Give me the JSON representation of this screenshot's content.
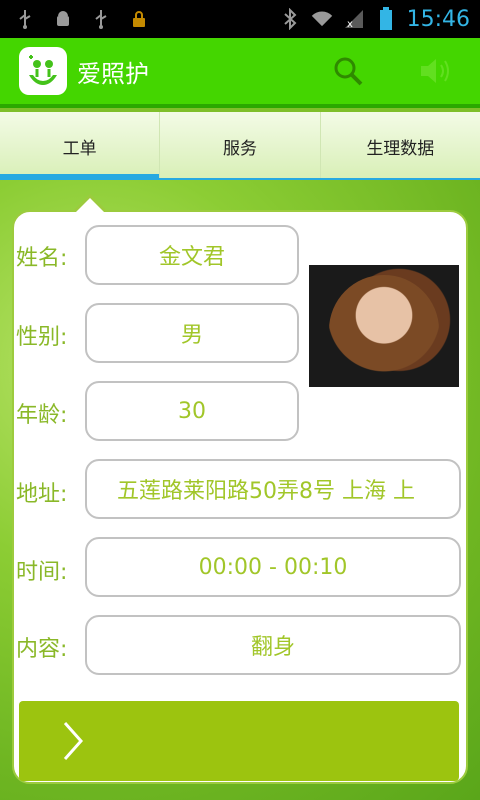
{
  "status_bar": {
    "time": "15:46",
    "icons": [
      "usb-icon",
      "android-debug-icon",
      "usb-icon",
      "lock-icon",
      "bluetooth-icon",
      "wifi-icon",
      "signal-icon",
      "battery-icon"
    ]
  },
  "app": {
    "title": "爱照护",
    "logo_icon": "caregiver-hands-icon",
    "actions": [
      "search-icon",
      "volume-icon"
    ]
  },
  "tabs": [
    {
      "label": "工单",
      "active": true
    },
    {
      "label": "服务",
      "active": false
    },
    {
      "label": "生理数据",
      "active": false
    }
  ],
  "form": {
    "name": {
      "label": "姓名:",
      "value": "金文君"
    },
    "gender": {
      "label": "性别:",
      "value": "男"
    },
    "age": {
      "label": "年龄:",
      "value": "30"
    },
    "address": {
      "label": "地址:",
      "value": "五莲路莱阳路50弄8号 上海 上"
    },
    "time": {
      "label": "时间:",
      "value": "00:00 - 00:10"
    },
    "content": {
      "label": "内容:",
      "value": "翻身"
    }
  },
  "next_button": {
    "icon": "chevron-right-icon"
  },
  "colors": {
    "status_bar": "#000000",
    "app_bar": "#44d600",
    "tab_indicator": "#27a9e1",
    "label_green": "#8ab828",
    "value_green": "#a1c629",
    "button": "#9cc40f"
  }
}
